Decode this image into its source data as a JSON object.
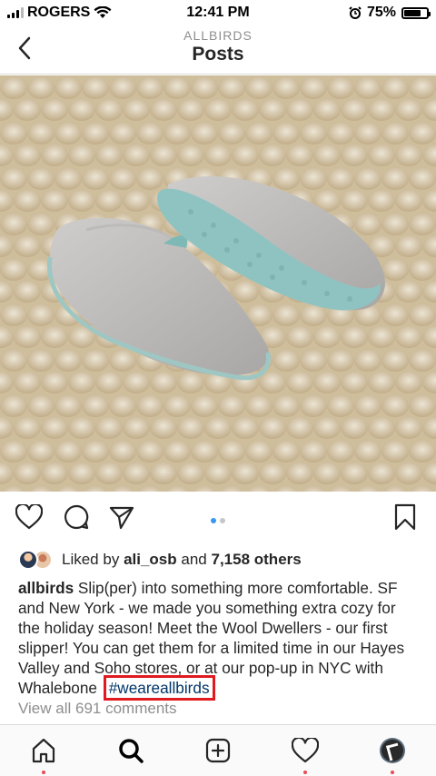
{
  "status_bar": {
    "carrier": "ROGERS",
    "time": "12:41 PM",
    "battery": "75%",
    "battery_level": 0.75
  },
  "header": {
    "account": "ALLBIRDS",
    "title": "Posts"
  },
  "carousel": {
    "pages": 2,
    "active_page": 1
  },
  "likes": {
    "prefix": "Liked by",
    "user": "ali_osb",
    "joiner": "and",
    "others": "7,158 others"
  },
  "caption": {
    "author": "allbirds",
    "text": "Slip(per) into something more comfortable. SF and New York - we made you something extra cozy for the holiday season! Meet the Wool Dwellers - our first slipper! You can get them for a limited time in our Hayes Valley and Soho stores, or at our pop-up in NYC with Whalebone",
    "hashtag": "#weareallbirds"
  },
  "comments": {
    "view_all": "View all 691 comments"
  },
  "colors": {
    "hashtag": "#003569",
    "highlight_box": "#e11921",
    "notification_dot": "#ed4956",
    "active_dot": "#3897f0"
  },
  "tabs": [
    "home-icon",
    "search-icon",
    "add-icon",
    "heart-icon",
    "profile-avatar"
  ]
}
